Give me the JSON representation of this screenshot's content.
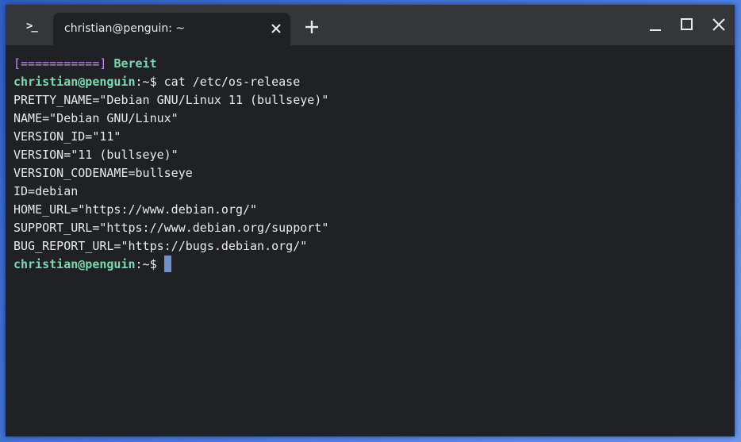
{
  "window": {
    "tab_title": "christian@penguin: ~",
    "app_icon": ">_",
    "icons": {
      "app": "terminal-icon",
      "tab_close": "close-icon",
      "new_tab": "plus-icon",
      "minimize": "minimize-icon",
      "maximize": "maximize-icon",
      "close": "close-icon"
    }
  },
  "terminal": {
    "status_line": {
      "progress": "[===========]",
      "ready": "Bereit"
    },
    "prompt": {
      "user_host": "christian@penguin",
      "path_symbol": ":~$"
    },
    "command": "cat /etc/os-release",
    "output": [
      "PRETTY_NAME=\"Debian GNU/Linux 11 (bullseye)\"",
      "NAME=\"Debian GNU/Linux\"",
      "VERSION_ID=\"11\"",
      "VERSION=\"11 (bullseye)\"",
      "VERSION_CODENAME=bullseye",
      "ID=debian",
      "HOME_URL=\"https://www.debian.org/\"",
      "SUPPORT_URL=\"https://www.debian.org/support\"",
      "BUG_REPORT_URL=\"https://bugs.debian.org/\""
    ]
  },
  "colors": {
    "background": "#202124",
    "titlebar": "#35363a",
    "prompt_user": "#78d9b0",
    "progress": "#c58af9",
    "cursor": "#7091c9",
    "text": "#e8eaed"
  }
}
